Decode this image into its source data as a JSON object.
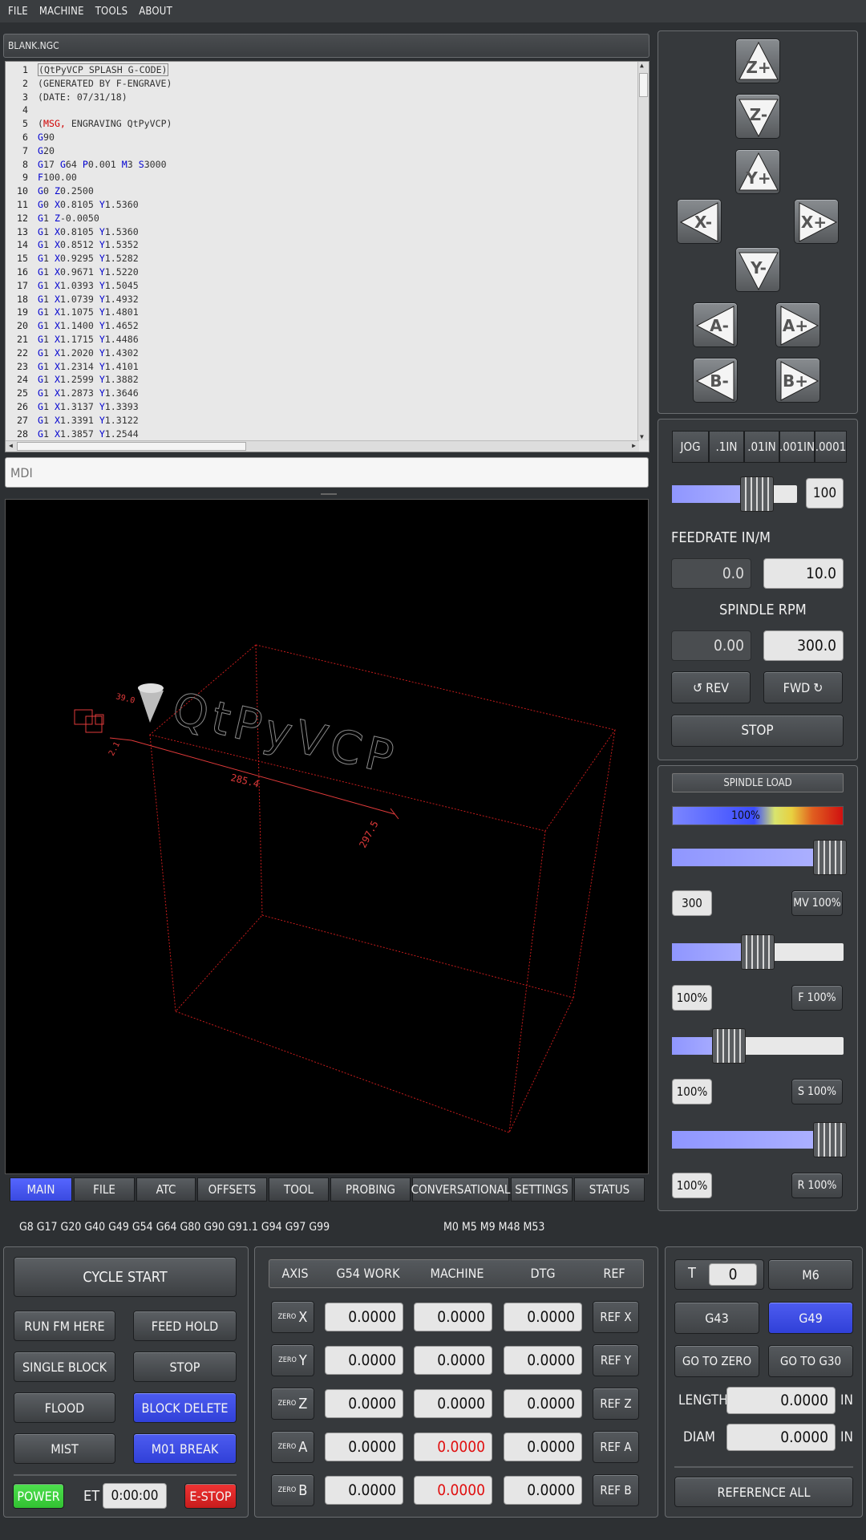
{
  "menu": [
    "FILE",
    "MACHINE",
    "TOOLS",
    "ABOUT"
  ],
  "file": {
    "name": "BLANK.NGC"
  },
  "gcode": [
    {
      "n": "1",
      "t": [
        [
          "cm",
          "(QtPyVCP SPLASH G-CODE)"
        ]
      ]
    },
    {
      "n": "2",
      "t": [
        [
          "cm",
          "(GENERATED BY F-ENGRAVE)"
        ]
      ]
    },
    {
      "n": "3",
      "t": [
        [
          "cm",
          "(DATE: 07/31/18)"
        ]
      ]
    },
    {
      "n": "4",
      "t": []
    },
    {
      "n": "5",
      "t": [
        [
          "cm",
          "("
        ],
        [
          "msg",
          "MSG,"
        ],
        [
          "cm",
          " ENGRAVING QtPyVCP)"
        ]
      ]
    },
    {
      "n": "6",
      "t": [
        [
          "kw",
          "G"
        ],
        [
          "cm",
          "90"
        ]
      ]
    },
    {
      "n": "7",
      "t": [
        [
          "kw",
          "G"
        ],
        [
          "cm",
          "20"
        ]
      ]
    },
    {
      "n": "8",
      "t": [
        [
          "kw",
          "G"
        ],
        [
          "cm",
          "17 "
        ],
        [
          "kw",
          "G"
        ],
        [
          "cm",
          "64 "
        ],
        [
          "kw",
          "P"
        ],
        [
          "cm",
          "0.001 "
        ],
        [
          "kw",
          "M"
        ],
        [
          "cm",
          "3 "
        ],
        [
          "kw",
          "S"
        ],
        [
          "cm",
          "3000"
        ]
      ]
    },
    {
      "n": "9",
      "t": [
        [
          "kw",
          "F"
        ],
        [
          "cm",
          "100.00"
        ]
      ]
    },
    {
      "n": "10",
      "t": [
        [
          "kw",
          "G"
        ],
        [
          "cm",
          "0 "
        ],
        [
          "kw",
          "Z"
        ],
        [
          "cm",
          "0.2500"
        ]
      ]
    },
    {
      "n": "11",
      "t": [
        [
          "kw",
          "G"
        ],
        [
          "cm",
          "0 "
        ],
        [
          "kw",
          "X"
        ],
        [
          "cm",
          "0.8105 "
        ],
        [
          "kw",
          "Y"
        ],
        [
          "cm",
          "1.5360"
        ]
      ]
    },
    {
      "n": "12",
      "t": [
        [
          "kw",
          "G"
        ],
        [
          "cm",
          "1 "
        ],
        [
          "kw",
          "Z"
        ],
        [
          "cm",
          "-0.0050"
        ]
      ]
    },
    {
      "n": "13",
      "t": [
        [
          "kw",
          "G"
        ],
        [
          "cm",
          "1 "
        ],
        [
          "kw",
          "X"
        ],
        [
          "cm",
          "0.8105 "
        ],
        [
          "kw",
          "Y"
        ],
        [
          "cm",
          "1.5360"
        ]
      ]
    },
    {
      "n": "14",
      "t": [
        [
          "kw",
          "G"
        ],
        [
          "cm",
          "1 "
        ],
        [
          "kw",
          "X"
        ],
        [
          "cm",
          "0.8512 "
        ],
        [
          "kw",
          "Y"
        ],
        [
          "cm",
          "1.5352"
        ]
      ]
    },
    {
      "n": "15",
      "t": [
        [
          "kw",
          "G"
        ],
        [
          "cm",
          "1 "
        ],
        [
          "kw",
          "X"
        ],
        [
          "cm",
          "0.9295 "
        ],
        [
          "kw",
          "Y"
        ],
        [
          "cm",
          "1.5282"
        ]
      ]
    },
    {
      "n": "16",
      "t": [
        [
          "kw",
          "G"
        ],
        [
          "cm",
          "1 "
        ],
        [
          "kw",
          "X"
        ],
        [
          "cm",
          "0.9671 "
        ],
        [
          "kw",
          "Y"
        ],
        [
          "cm",
          "1.5220"
        ]
      ]
    },
    {
      "n": "17",
      "t": [
        [
          "kw",
          "G"
        ],
        [
          "cm",
          "1 "
        ],
        [
          "kw",
          "X"
        ],
        [
          "cm",
          "1.0393 "
        ],
        [
          "kw",
          "Y"
        ],
        [
          "cm",
          "1.5045"
        ]
      ]
    },
    {
      "n": "18",
      "t": [
        [
          "kw",
          "G"
        ],
        [
          "cm",
          "1 "
        ],
        [
          "kw",
          "X"
        ],
        [
          "cm",
          "1.0739 "
        ],
        [
          "kw",
          "Y"
        ],
        [
          "cm",
          "1.4932"
        ]
      ]
    },
    {
      "n": "19",
      "t": [
        [
          "kw",
          "G"
        ],
        [
          "cm",
          "1 "
        ],
        [
          "kw",
          "X"
        ],
        [
          "cm",
          "1.1075 "
        ],
        [
          "kw",
          "Y"
        ],
        [
          "cm",
          "1.4801"
        ]
      ]
    },
    {
      "n": "20",
      "t": [
        [
          "kw",
          "G"
        ],
        [
          "cm",
          "1 "
        ],
        [
          "kw",
          "X"
        ],
        [
          "cm",
          "1.1400 "
        ],
        [
          "kw",
          "Y"
        ],
        [
          "cm",
          "1.4652"
        ]
      ]
    },
    {
      "n": "21",
      "t": [
        [
          "kw",
          "G"
        ],
        [
          "cm",
          "1 "
        ],
        [
          "kw",
          "X"
        ],
        [
          "cm",
          "1.1715 "
        ],
        [
          "kw",
          "Y"
        ],
        [
          "cm",
          "1.4486"
        ]
      ]
    },
    {
      "n": "22",
      "t": [
        [
          "kw",
          "G"
        ],
        [
          "cm",
          "1 "
        ],
        [
          "kw",
          "X"
        ],
        [
          "cm",
          "1.2020 "
        ],
        [
          "kw",
          "Y"
        ],
        [
          "cm",
          "1.4302"
        ]
      ]
    },
    {
      "n": "23",
      "t": [
        [
          "kw",
          "G"
        ],
        [
          "cm",
          "1 "
        ],
        [
          "kw",
          "X"
        ],
        [
          "cm",
          "1.2314 "
        ],
        [
          "kw",
          "Y"
        ],
        [
          "cm",
          "1.4101"
        ]
      ]
    },
    {
      "n": "24",
      "t": [
        [
          "kw",
          "G"
        ],
        [
          "cm",
          "1 "
        ],
        [
          "kw",
          "X"
        ],
        [
          "cm",
          "1.2599 "
        ],
        [
          "kw",
          "Y"
        ],
        [
          "cm",
          "1.3882"
        ]
      ]
    },
    {
      "n": "25",
      "t": [
        [
          "kw",
          "G"
        ],
        [
          "cm",
          "1 "
        ],
        [
          "kw",
          "X"
        ],
        [
          "cm",
          "1.2873 "
        ],
        [
          "kw",
          "Y"
        ],
        [
          "cm",
          "1.3646"
        ]
      ]
    },
    {
      "n": "26",
      "t": [
        [
          "kw",
          "G"
        ],
        [
          "cm",
          "1 "
        ],
        [
          "kw",
          "X"
        ],
        [
          "cm",
          "1.3137 "
        ],
        [
          "kw",
          "Y"
        ],
        [
          "cm",
          "1.3393"
        ]
      ]
    },
    {
      "n": "27",
      "t": [
        [
          "kw",
          "G"
        ],
        [
          "cm",
          "1 "
        ],
        [
          "kw",
          "X"
        ],
        [
          "cm",
          "1.3391 "
        ],
        [
          "kw",
          "Y"
        ],
        [
          "cm",
          "1.3122"
        ]
      ]
    },
    {
      "n": "28",
      "t": [
        [
          "kw",
          "G"
        ],
        [
          "cm",
          "1 "
        ],
        [
          "kw",
          "X"
        ],
        [
          "cm",
          "1.3857 "
        ],
        [
          "kw",
          "Y"
        ],
        [
          "cm",
          "1.2544"
        ]
      ]
    }
  ],
  "mdi": {
    "placeholder": "MDI"
  },
  "viewer": {
    "text": "QtPyVCP",
    "dim_x": "285.4",
    "dim_y": "297.5",
    "dim_a": "39.0",
    "dim_b": "2.1",
    "line_color": "#d42020"
  },
  "jog_buttons": {
    "z_plus": "Z+",
    "z_minus": "Z-",
    "y_plus": "Y+",
    "y_minus": "Y-",
    "x_minus": "X-",
    "x_plus": "X+",
    "a_minus": "A-",
    "a_plus": "A+",
    "b_minus": "B-",
    "b_plus": "B+"
  },
  "increments": [
    "JOG",
    ".1IN",
    ".01IN",
    ".001IN",
    ".0001"
  ],
  "jog_speed": {
    "value": "100",
    "level": 0.68
  },
  "feedrate": {
    "label": "FEEDRATE IN/M",
    "actual": "0.0",
    "set": "10.0"
  },
  "spindle": {
    "label": "SPINDLE RPM",
    "actual": "0.00",
    "set": "300.0",
    "rev": "REV",
    "fwd": "FWD",
    "stop": "STOP"
  },
  "spindle_load": {
    "label": "SPINDLE LOAD",
    "value": "100%",
    "level": 0.53
  },
  "overrides": [
    {
      "value": "300",
      "button": "MV 100%",
      "level": 0.92
    },
    {
      "value": "100%",
      "button": "F 100%",
      "level": 0.5
    },
    {
      "value": "100%",
      "button": "S 100%",
      "level": 0.33
    },
    {
      "value": "100%",
      "button": "R 100%",
      "level": 0.92
    }
  ],
  "tabs": [
    "MAIN",
    "FILE",
    "ATC",
    "OFFSETS",
    "TOOL",
    "PROBING",
    "CONVERSATIONAL",
    "SETTINGS",
    "STATUS"
  ],
  "active_tab": "MAIN",
  "gcodes_active": "G8 G17 G20 G40 G49 G54 G64 G80 G90 G91.1 G94 G97 G99",
  "mcodes_active": "M0 M5 M9 M48 M53",
  "controls": {
    "cycle_start": "CYCLE START",
    "run_from_here": "RUN FM HERE",
    "feed_hold": "FEED HOLD",
    "single_block": "SINGLE BLOCK",
    "stop": "STOP",
    "flood": "FLOOD",
    "block_delete": "BLOCK DELETE",
    "mist": "MIST",
    "m01_break": "M01 BREAK",
    "power": "POWER",
    "et_label": "ET",
    "et_value": "0:00:00",
    "estop": "E-STOP"
  },
  "dro": {
    "headers": [
      "AXIS",
      "G54 WORK",
      "MACHINE",
      "DTG",
      "REF"
    ],
    "zero_label": "ZERO",
    "rows": [
      {
        "axis": "X",
        "work": "0.0000",
        "machine": "0.0000",
        "dtg": "0.0000",
        "ref": "REF X",
        "machine_red": false
      },
      {
        "axis": "Y",
        "work": "0.0000",
        "machine": "0.0000",
        "dtg": "0.0000",
        "ref": "REF Y",
        "machine_red": false
      },
      {
        "axis": "Z",
        "work": "0.0000",
        "machine": "0.0000",
        "dtg": "0.0000",
        "ref": "REF Z",
        "machine_red": false
      },
      {
        "axis": "A",
        "work": "0.0000",
        "machine": "0.0000",
        "dtg": "0.0000",
        "ref": "REF A",
        "machine_red": true
      },
      {
        "axis": "B",
        "work": "0.0000",
        "machine": "0.0000",
        "dtg": "0.0000",
        "ref": "REF B",
        "machine_red": true
      }
    ]
  },
  "tool": {
    "t_label": "T",
    "t_value": "0",
    "m6": "M6",
    "g43": "G43",
    "g49": "G49",
    "go_zero": "GO TO ZERO",
    "go_g30": "GO TO G30",
    "length_label": "LENGTH",
    "length": "0.0000",
    "diam_label": "DIAM",
    "diam": "0.0000",
    "unit": "IN",
    "ref_all": "REFERENCE ALL"
  }
}
